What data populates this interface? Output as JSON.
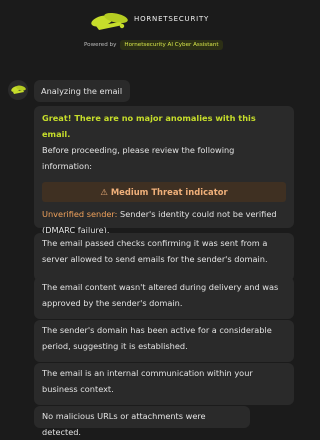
{
  "header": {
    "brand": "HORNETSECURITY",
    "powered_label": "Powered by",
    "assistant_name": "Hornetsecurity AI Cyber Assistant",
    "logo_icon": "hornet-logo-icon",
    "accent_color": "#c6dd2b"
  },
  "chat": {
    "avatar_icon": "hornet-avatar-icon",
    "analyzing": "Analyzing the email",
    "headline": "Great! There are no major anomalies with this email.",
    "intro": "Before proceeding, please review the following information:",
    "threat_indicator": "Medium Threat indicator",
    "warning_icon": "warning-icon",
    "unverified_label": "Unverified sender:",
    "unverified_text": "Sender's identity could not be verified (DMARC failure).",
    "points": [
      "The email passed checks confirming it was sent from a server allowed to send emails for the sender's domain.",
      "The email content wasn't altered during delivery and was approved by the sender's domain.",
      "The sender's domain has been active for a considerable period, suggesting it is established.",
      "The email is an internal communication within your business context.",
      "No malicious URLs or attachments were detected."
    ]
  }
}
